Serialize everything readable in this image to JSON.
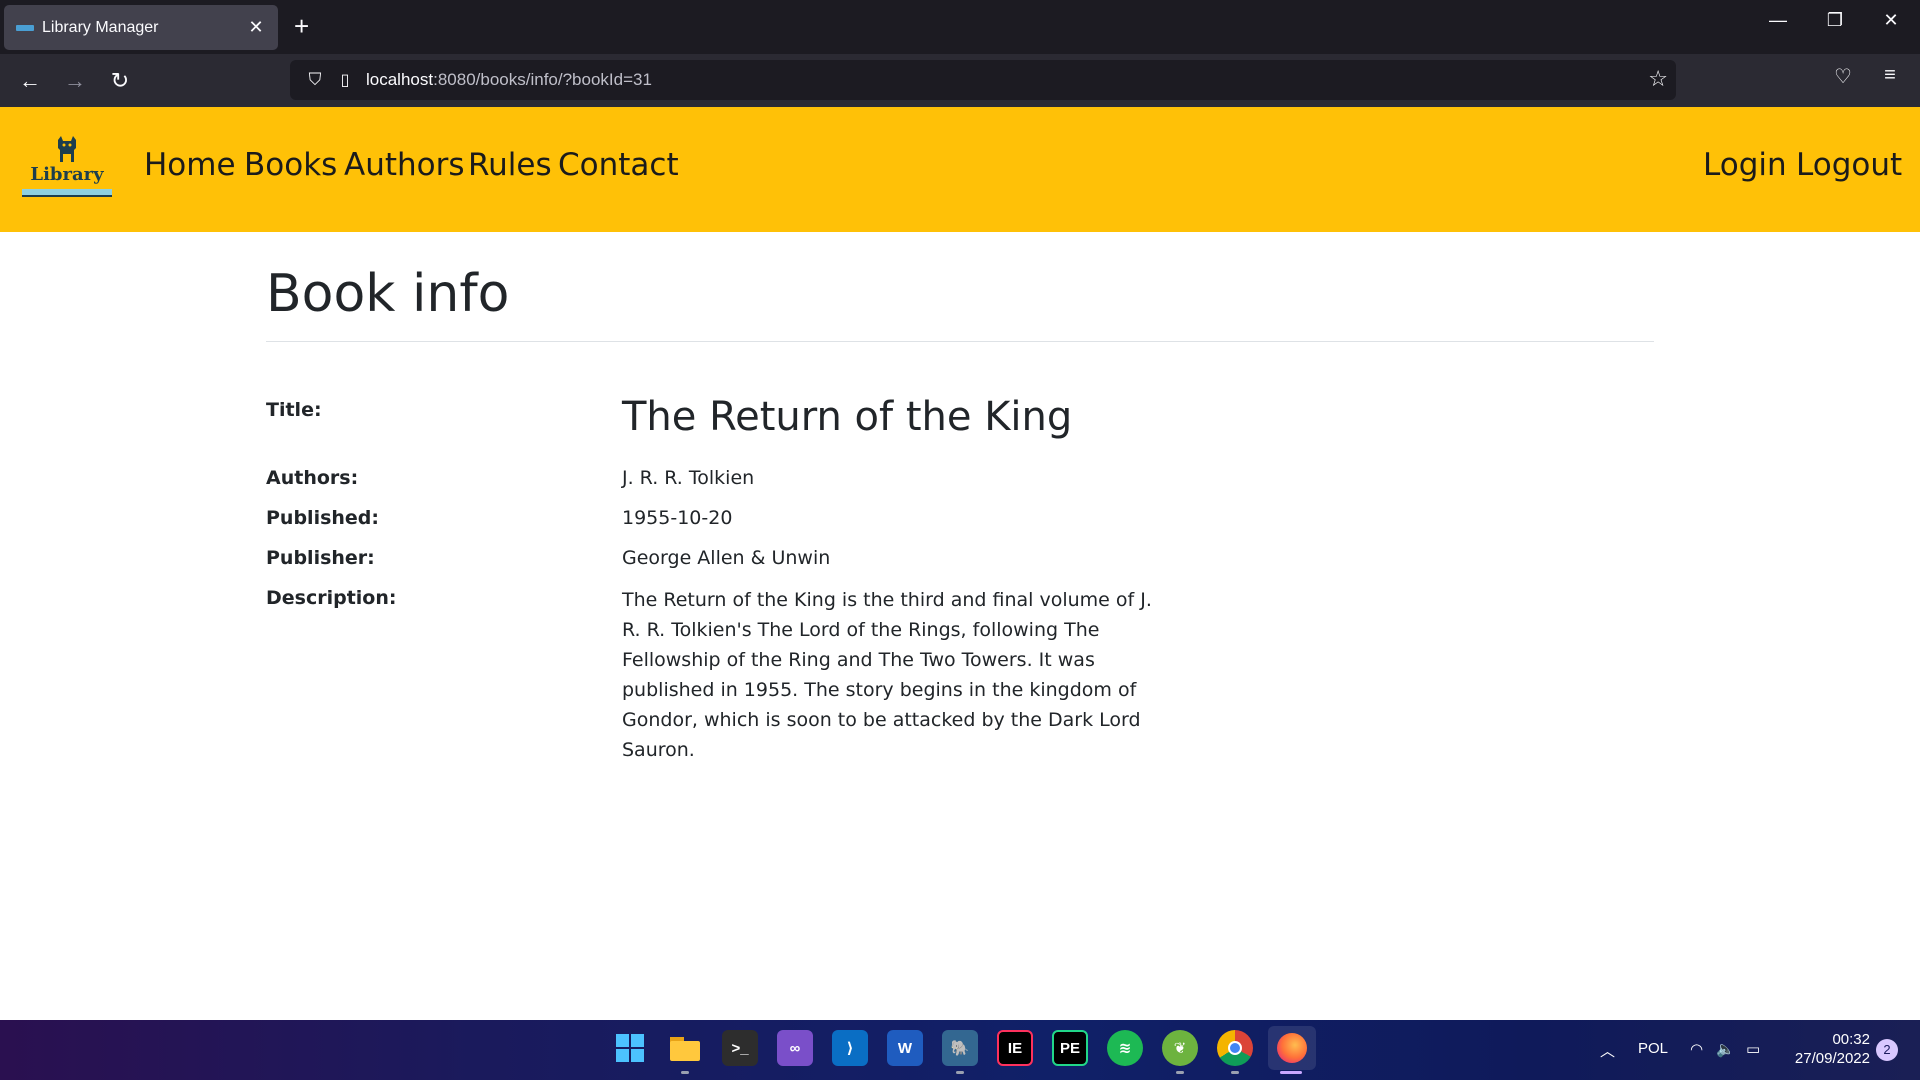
{
  "browser": {
    "tab_title": "Library Manager",
    "tab_close": "✕",
    "new_tab": "+",
    "url_host": "localhost",
    "url_rest": ":8080/books/info/?bookId=31",
    "controls": {
      "minimize": "—",
      "restore": "❐",
      "close": "✕"
    }
  },
  "site": {
    "logo_text": "Library",
    "menu_left": [
      "Home",
      "Books",
      "Authors",
      "Rules",
      "Contact"
    ],
    "menu_right": [
      "Login",
      "Logout"
    ],
    "accent": "#ffc107"
  },
  "page": {
    "heading": "Book info",
    "fields": {
      "title_label": "Title:",
      "title_value": "The Return of the King",
      "authors_label": "Authors:",
      "authors_value": "J. R. R. Tolkien",
      "published_label": "Published:",
      "published_value": "1955-10-20",
      "publisher_label": "Publisher:",
      "publisher_value": "George Allen & Unwin",
      "description_label": "Description:",
      "description_value": "The Return of the King is the third and final volume of J. R. R. Tolkien's The Lord of the Rings, following The Fellowship of the Ring and The Two Towers. It was published in 1955. The story begins in the kingdom of Gondor, which is soon to be attacked by the Dark Lord Sauron."
    }
  },
  "taskbar": {
    "icons": [
      "windows-start-icon",
      "file-explorer-icon",
      "terminal-icon",
      "visual-studio-icon",
      "vscode-icon",
      "word-icon",
      "postgresql-icon",
      "intellij-icon",
      "pycharm-icon",
      "spotify-icon",
      "spring-icon",
      "chrome-icon",
      "firefox-icon"
    ],
    "language": "POL",
    "time": "00:32",
    "date": "27/09/2022",
    "notifications": "2"
  }
}
